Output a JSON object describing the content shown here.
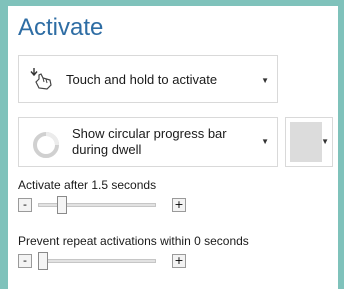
{
  "title": "Activate",
  "activation_mode": {
    "value": "Touch and hold to activate",
    "icon": "touch-hold-hand-icon"
  },
  "dwell_feedback": {
    "value": "Show circular progress bar during dwell",
    "icon": "circular-progress-icon"
  },
  "progress_color": {
    "value": "#dcdcdc"
  },
  "activate_after": {
    "label": "Activate after 1.5 seconds",
    "minus_label": "-",
    "plus_label": "+",
    "level": 0.18
  },
  "prevent_repeat": {
    "label": "Prevent repeat activations within 0 seconds",
    "minus_label": "-",
    "plus_label": "+",
    "level": 0.0
  }
}
